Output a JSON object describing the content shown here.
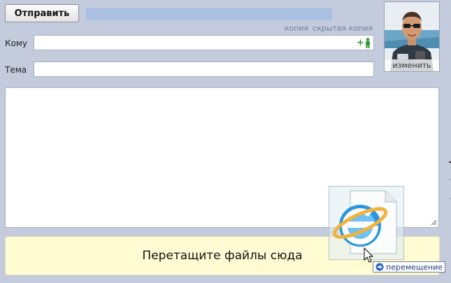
{
  "compose": {
    "send_label": "Отправить",
    "cc_label": "копия",
    "bcc_label": "скрытая копия",
    "to_label": "Кому",
    "to_value": "",
    "add_contact_symbol": "+",
    "subject_label": "Тема",
    "subject_value": "",
    "body_value": ""
  },
  "avatar": {
    "change_label": "изменить"
  },
  "dropzone": {
    "text": "Перетащите файлы сюда"
  },
  "drag": {
    "file_icon": "internet-explorer-file-icon",
    "action_label": "перемещение",
    "action_icon": "arrow-right-icon"
  },
  "colors": {
    "background": "#c3cbdc",
    "status_bar": "#a9c0e3",
    "dropzone": "#fffbd2",
    "link": "#6f7f9c",
    "add_contact": "#2e9a2e"
  }
}
